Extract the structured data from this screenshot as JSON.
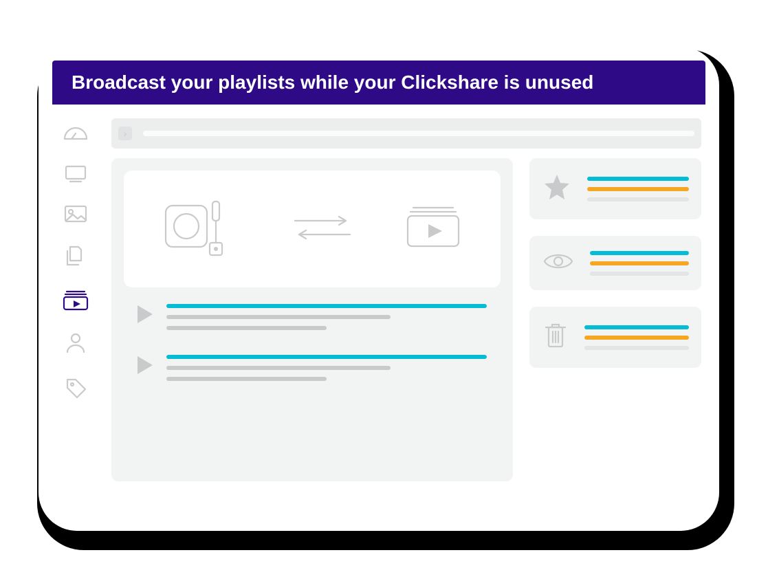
{
  "header": {
    "title": "Broadcast your playlists while your Clickshare is unused"
  },
  "colors": {
    "brand": "#2e0a87",
    "accent_cyan": "#06bcd5",
    "accent_amber": "#f5a623",
    "muted": "#c9cacb"
  },
  "sidebar": {
    "items": [
      {
        "name": "dashboard-icon",
        "active": false
      },
      {
        "name": "monitor-icon",
        "active": false
      },
      {
        "name": "image-icon",
        "active": false
      },
      {
        "name": "files-icon",
        "active": false
      },
      {
        "name": "playlist-icon",
        "active": true
      },
      {
        "name": "user-icon",
        "active": false
      },
      {
        "name": "tag-icon",
        "active": false
      }
    ]
  },
  "side_cards": [
    {
      "icon": "star-icon"
    },
    {
      "icon": "eye-icon"
    },
    {
      "icon": "trash-icon"
    }
  ]
}
